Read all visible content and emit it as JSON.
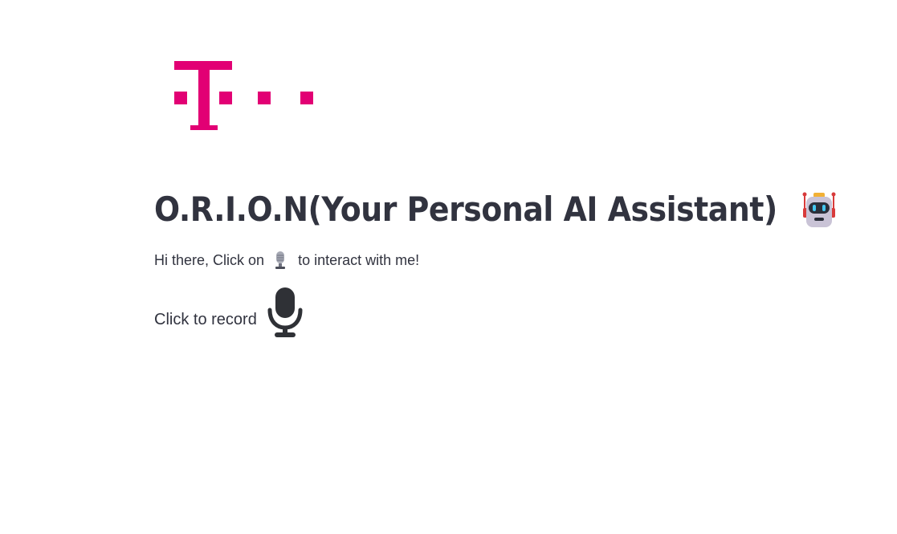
{
  "brand": {
    "logo_name": "telekom-logo",
    "color": "#e20074"
  },
  "header": {
    "title": "O.R.I.O.N(Your Personal AI Assistant)",
    "title_icon": "robot-icon"
  },
  "intro": {
    "before_icon": "Hi there, Click on",
    "icon": "microphone-icon",
    "after_icon": "to interact with me!"
  },
  "recorder": {
    "label": "Click to record",
    "icon": "microphone-icon"
  }
}
